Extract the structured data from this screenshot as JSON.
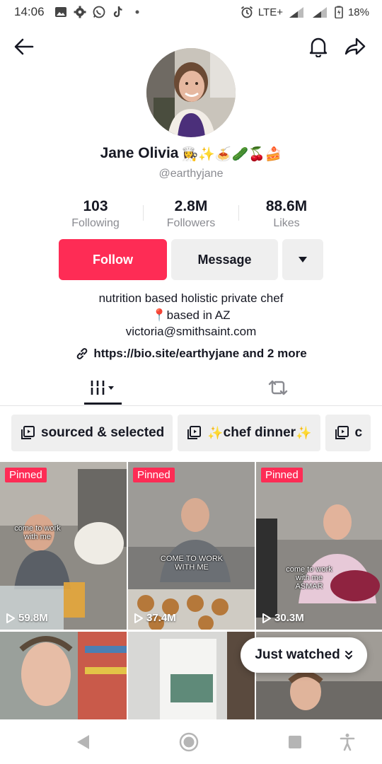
{
  "status_bar": {
    "time": "14:06",
    "network": "LTE+",
    "battery": "18%",
    "notification_icons": [
      "gallery-icon",
      "settings-icon",
      "whatsapp-icon",
      "tiktok-icon",
      "dot-icon"
    ]
  },
  "header": {
    "back_icon": "arrow-left-icon",
    "bell_icon": "bell-icon",
    "share_icon": "share-icon"
  },
  "profile": {
    "name": "Jane Olivia",
    "name_emojis": "👩‍🍳✨🍝🥒🍒🍰",
    "handle": "@earthyjane",
    "stats": [
      {
        "value": "103",
        "label": "Following"
      },
      {
        "value": "2.8M",
        "label": "Followers"
      },
      {
        "value": "88.6M",
        "label": "Likes"
      }
    ],
    "buttons": {
      "follow": "Follow",
      "message": "Message"
    },
    "bio": [
      "nutrition based holistic private chef",
      "📍based in AZ",
      "victoria@smithsaint.com"
    ],
    "link": "https://bio.site/earthyjane and 2 more"
  },
  "colors": {
    "accent": "#fe2c55",
    "text": "#161823",
    "secondary": "#8a8b91",
    "chip_bg": "#efefef"
  },
  "playlists": [
    {
      "icon": "playlist-icon",
      "prefix": "",
      "label": "sourced & selected",
      "suffix": ""
    },
    {
      "icon": "playlist-icon",
      "prefix": "✨",
      "label": "chef dinner",
      "suffix": "✨"
    },
    {
      "icon": "playlist-icon",
      "prefix": "",
      "label": "c",
      "suffix": ""
    }
  ],
  "videos": [
    {
      "pinned": "Pinned",
      "views": "59.8M",
      "overlay": "come to work with me"
    },
    {
      "pinned": "Pinned",
      "views": "37.4M",
      "overlay": "COME TO WORK WITH ME"
    },
    {
      "pinned": "Pinned",
      "views": "30.3M",
      "overlay": "come to work with me ASMAR"
    },
    {
      "pinned": "",
      "views": "",
      "overlay": ""
    },
    {
      "pinned": "",
      "views": "",
      "overlay": ""
    },
    {
      "pinned": "",
      "views": "",
      "overlay": ""
    }
  ],
  "just_watched": "Just watched"
}
